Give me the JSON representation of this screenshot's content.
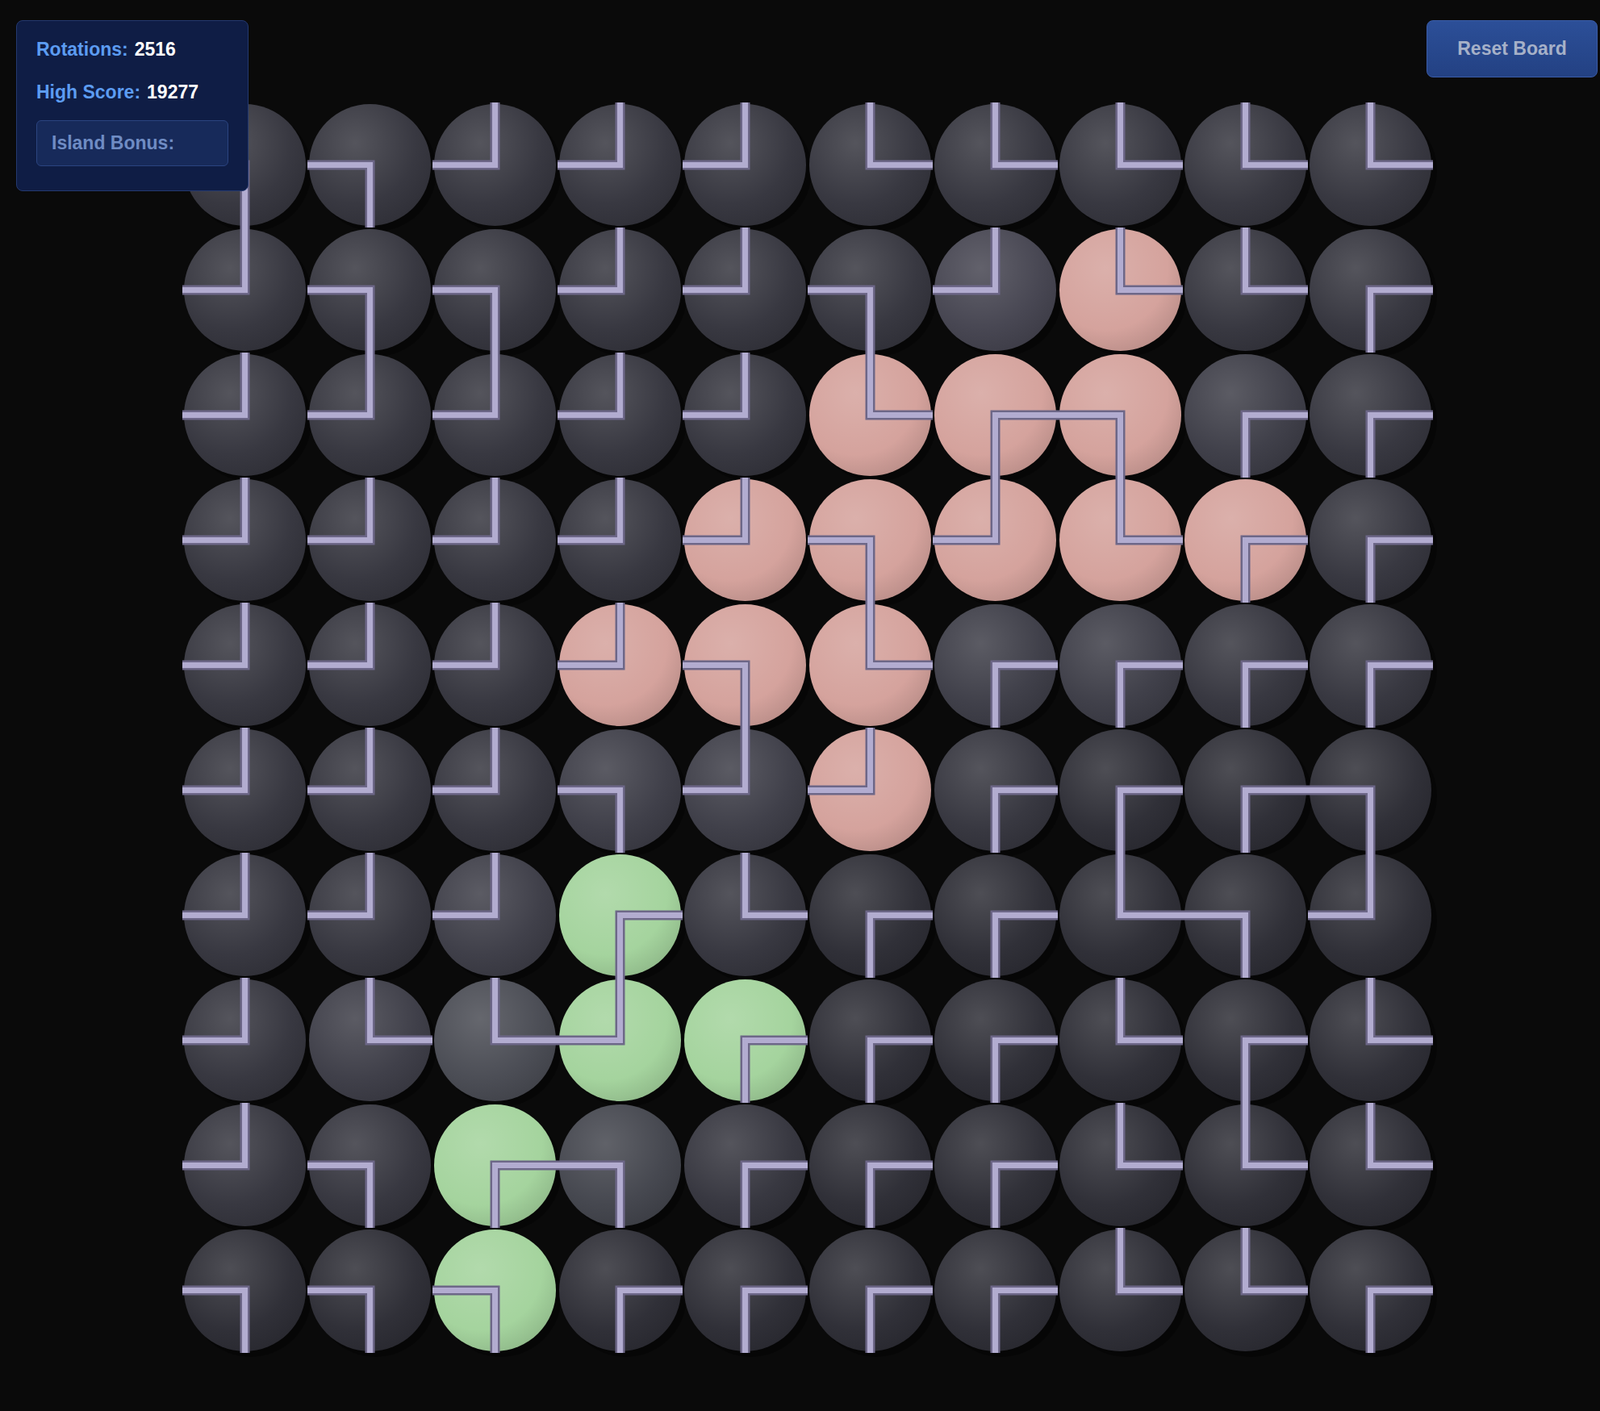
{
  "stats": [
    {
      "label": "Rotations:",
      "value": "2516"
    },
    {
      "label": "High Score:",
      "value": "19277"
    }
  ],
  "island_bonus": {
    "label": "Island Bonus:"
  },
  "reset_button": "Reset Board",
  "board": {
    "rows": [
      [
        {
          "pipe": "WS",
          "color": "#34343d"
        },
        {
          "pipe": "WS",
          "color": "#34343d"
        },
        {
          "pipe": "NW",
          "color": "#34343d"
        },
        {
          "pipe": "NW",
          "color": "#34343d"
        },
        {
          "pipe": "NW",
          "color": "#34343d"
        },
        {
          "pipe": "NE",
          "color": "#34343d"
        },
        {
          "pipe": "NE",
          "color": "#34343d"
        },
        {
          "pipe": "NE",
          "color": "#34343d"
        },
        {
          "pipe": "NE",
          "color": "#34343d"
        },
        {
          "pipe": "NE",
          "color": "#34343d"
        }
      ],
      [
        {
          "pipe": "NW",
          "color": "#34343d"
        },
        {
          "pipe": "WS",
          "color": "#34343d"
        },
        {
          "pipe": "WS",
          "color": "#34343d"
        },
        {
          "pipe": "NW",
          "color": "#34343d"
        },
        {
          "pipe": "NW",
          "color": "#34343d"
        },
        {
          "pipe": "WS",
          "color": "#34343d"
        },
        {
          "pipe": "NW",
          "color": "#44434f"
        },
        {
          "pipe": "NE",
          "color": "#d4a19b"
        },
        {
          "pipe": "NE",
          "color": "#34343d"
        },
        {
          "pipe": "ES",
          "color": "#34343d"
        }
      ],
      [
        {
          "pipe": "NW",
          "color": "#34343d"
        },
        {
          "pipe": "NW",
          "color": "#34343d"
        },
        {
          "pipe": "NW",
          "color": "#34343d"
        },
        {
          "pipe": "NW",
          "color": "#34343d"
        },
        {
          "pipe": "NW",
          "color": "#34343d"
        },
        {
          "pipe": "NE",
          "color": "#d4a19b"
        },
        {
          "pipe": "ES",
          "color": "#d4a19b"
        },
        {
          "pipe": "WS",
          "color": "#d4a19b"
        },
        {
          "pipe": "ES",
          "color": "#3c3c46"
        },
        {
          "pipe": "ES",
          "color": "#34343d"
        }
      ],
      [
        {
          "pipe": "NW",
          "color": "#34343d"
        },
        {
          "pipe": "NW",
          "color": "#34343d"
        },
        {
          "pipe": "NW",
          "color": "#34343d"
        },
        {
          "pipe": "NW",
          "color": "#34343d"
        },
        {
          "pipe": "NW",
          "color": "#d4a19b"
        },
        {
          "pipe": "WS",
          "color": "#d4a19b"
        },
        {
          "pipe": "NW",
          "color": "#d4a19b"
        },
        {
          "pipe": "NE",
          "color": "#d4a19b"
        },
        {
          "pipe": "ES",
          "color": "#d4a19b"
        },
        {
          "pipe": "ES",
          "color": "#34343d"
        }
      ],
      [
        {
          "pipe": "NW",
          "color": "#34343d"
        },
        {
          "pipe": "NW",
          "color": "#34343d"
        },
        {
          "pipe": "NW",
          "color": "#34343d"
        },
        {
          "pipe": "NW",
          "color": "#d4a19b"
        },
        {
          "pipe": "WS",
          "color": "#d4a19b"
        },
        {
          "pipe": "NE",
          "color": "#d4a19b"
        },
        {
          "pipe": "ES",
          "color": "#3c3c46"
        },
        {
          "pipe": "ES",
          "color": "#3c3c46"
        },
        {
          "pipe": "ES",
          "color": "#34343d"
        },
        {
          "pipe": "ES",
          "color": "#34343d"
        }
      ],
      [
        {
          "pipe": "NW",
          "color": "#34343d"
        },
        {
          "pipe": "NW",
          "color": "#34343d"
        },
        {
          "pipe": "NW",
          "color": "#34343d"
        },
        {
          "pipe": "WS",
          "color": "#3c3c46"
        },
        {
          "pipe": "NW",
          "color": "#3c3c46"
        },
        {
          "pipe": "NW",
          "color": "#d4a19b"
        },
        {
          "pipe": "ES",
          "color": "#34343d"
        },
        {
          "pipe": "ES",
          "color": "#2c2c34"
        },
        {
          "pipe": "ES",
          "color": "#2c2c34"
        },
        {
          "pipe": "WS",
          "color": "#2c2c34"
        }
      ],
      [
        {
          "pipe": "NW",
          "color": "#34343d"
        },
        {
          "pipe": "NW",
          "color": "#34343d"
        },
        {
          "pipe": "NW",
          "color": "#3c3c46"
        },
        {
          "pipe": "ES",
          "color": "#a3d39c"
        },
        {
          "pipe": "NE",
          "color": "#34343d"
        },
        {
          "pipe": "ES",
          "color": "#2c2c34"
        },
        {
          "pipe": "ES",
          "color": "#2c2c34"
        },
        {
          "pipe": "NE",
          "color": "#2c2c34"
        },
        {
          "pipe": "WS",
          "color": "#2c2c34"
        },
        {
          "pipe": "NW",
          "color": "#2c2c34"
        }
      ],
      [
        {
          "pipe": "NW",
          "color": "#34343d"
        },
        {
          "pipe": "NE",
          "color": "#3c3c46"
        },
        {
          "pipe": "NE",
          "color": "#484a52"
        },
        {
          "pipe": "NW",
          "color": "#a3d39c"
        },
        {
          "pipe": "ES",
          "color": "#a3d39c"
        },
        {
          "pipe": "ES",
          "color": "#2c2c34"
        },
        {
          "pipe": "ES",
          "color": "#2c2c34"
        },
        {
          "pipe": "NE",
          "color": "#2c2c34"
        },
        {
          "pipe": "ES",
          "color": "#2c2c34"
        },
        {
          "pipe": "NE",
          "color": "#2c2c34"
        }
      ],
      [
        {
          "pipe": "NW",
          "color": "#34343d"
        },
        {
          "pipe": "WS",
          "color": "#34343d"
        },
        {
          "pipe": "ES",
          "color": "#a3d39c"
        },
        {
          "pipe": "WS",
          "color": "#42444c"
        },
        {
          "pipe": "ES",
          "color": "#34343d"
        },
        {
          "pipe": "ES",
          "color": "#2c2c34"
        },
        {
          "pipe": "ES",
          "color": "#2c2c34"
        },
        {
          "pipe": "NE",
          "color": "#2c2c34"
        },
        {
          "pipe": "NE",
          "color": "#2c2c34"
        },
        {
          "pipe": "NE",
          "color": "#2c2c34"
        }
      ],
      [
        {
          "pipe": "WS",
          "color": "#2c2c34"
        },
        {
          "pipe": "WS",
          "color": "#2c2c34"
        },
        {
          "pipe": "WS",
          "color": "#a3d39c"
        },
        {
          "pipe": "ES",
          "color": "#2c2c34"
        },
        {
          "pipe": "ES",
          "color": "#2c2c34"
        },
        {
          "pipe": "ES",
          "color": "#2c2c34"
        },
        {
          "pipe": "ES",
          "color": "#2c2c34"
        },
        {
          "pipe": "NE",
          "color": "#2c2c34"
        },
        {
          "pipe": "NE",
          "color": "#2c2c34"
        },
        {
          "pipe": "ES",
          "color": "#2c2c34"
        }
      ]
    ]
  }
}
